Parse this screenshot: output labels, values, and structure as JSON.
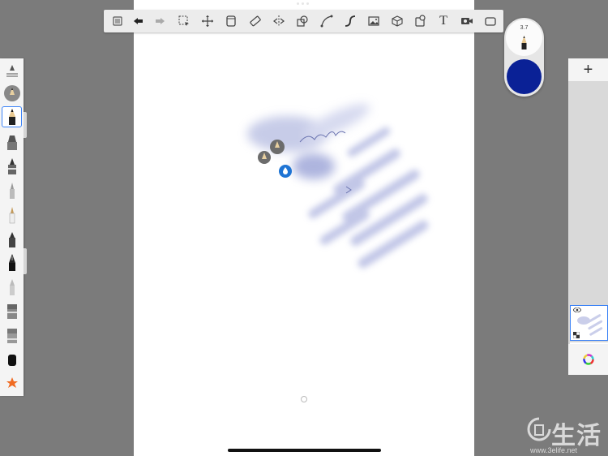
{
  "toolbar": {
    "tools": [
      {
        "name": "lagoon-menu-icon"
      },
      {
        "name": "undo-icon"
      },
      {
        "name": "redo-icon"
      },
      {
        "name": "selection-icon"
      },
      {
        "name": "transform-icon"
      },
      {
        "name": "layer-icon"
      },
      {
        "name": "ruler-icon"
      },
      {
        "name": "symmetry-icon"
      },
      {
        "name": "shapes-icon"
      },
      {
        "name": "curve-icon"
      },
      {
        "name": "stroke-icon"
      },
      {
        "name": "image-icon"
      },
      {
        "name": "perspective-icon"
      },
      {
        "name": "flood-fill-icon"
      },
      {
        "name": "text-icon"
      },
      {
        "name": "timelapse-icon"
      },
      {
        "name": "fullscreen-icon"
      }
    ],
    "text_tool_label": "T"
  },
  "puck": {
    "size_label": "3.7",
    "color": "#0a2196"
  },
  "right_panel": {
    "add_layer_label": "+"
  },
  "watermark": {
    "text": "生活",
    "url": "www.3elife.net"
  },
  "accent": "#3b82f6"
}
